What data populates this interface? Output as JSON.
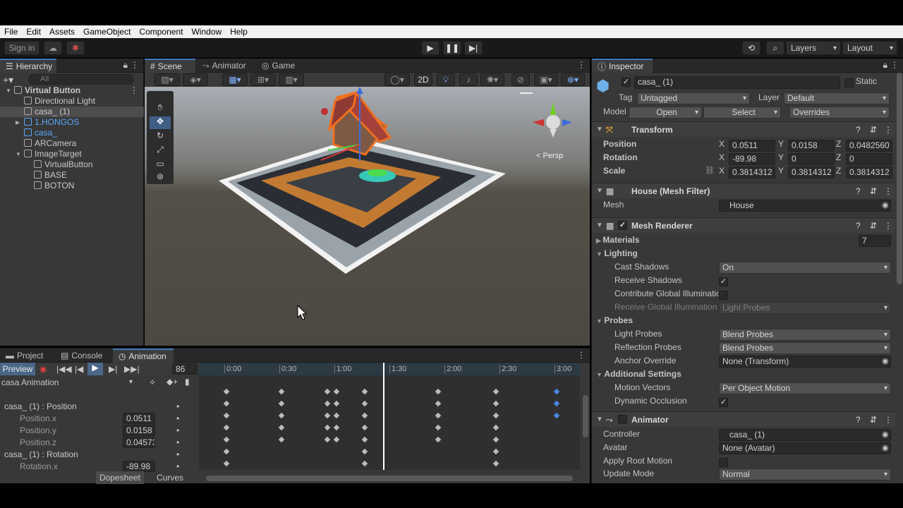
{
  "menu": [
    "File",
    "Edit",
    "Assets",
    "GameObject",
    "Component",
    "Window",
    "Help"
  ],
  "toolbar": {
    "sign_in": "Sign in",
    "layers": "Layers",
    "layout": "Layout"
  },
  "hierarchy": {
    "tab": "Hierarchy",
    "search_placeholder": "All",
    "items": [
      {
        "label": "Virtual Button",
        "indent": 0,
        "bold": true
      },
      {
        "label": "Directional Light",
        "indent": 1
      },
      {
        "label": "casa_ (1)",
        "indent": 1,
        "selected": true
      },
      {
        "label": "1.HONGOS",
        "indent": 1,
        "blue": true
      },
      {
        "label": "casa_",
        "indent": 1,
        "blue": true
      },
      {
        "label": "ARCamera",
        "indent": 1
      },
      {
        "label": "ImageTarget",
        "indent": 1
      },
      {
        "label": "VirtualButton",
        "indent": 2
      },
      {
        "label": "BASE",
        "indent": 2
      },
      {
        "label": "BOTON",
        "indent": 2
      }
    ]
  },
  "scene": {
    "tabs": [
      "Scene",
      "Animator",
      "Game"
    ],
    "mode_2d": "2D",
    "persp": "< Persp"
  },
  "animation": {
    "tabs": [
      "Project",
      "Console",
      "Animation"
    ],
    "preview": "Preview",
    "frame": "86",
    "clip": "casa Animation",
    "timeline": [
      "0:00",
      "0:30",
      "1:00",
      "1:30",
      "2:00",
      "2:30",
      "3:00"
    ],
    "props": [
      {
        "name": "casa_ (1) : Position",
        "value": "",
        "group": true
      },
      {
        "name": "Position.x",
        "value": "0.0511"
      },
      {
        "name": "Position.y",
        "value": "0.0158"
      },
      {
        "name": "Position.z",
        "value": "0.04573"
      },
      {
        "name": "casa_ (1) : Rotation",
        "value": "",
        "group": true
      },
      {
        "name": "Rotation.x",
        "value": "-89.98"
      }
    ],
    "dopesheet": "Dopesheet",
    "curves": "Curves"
  },
  "inspector": {
    "tab": "Inspector",
    "object_name": "casa_ (1)",
    "static": "Static",
    "tag_label": "Tag",
    "tag": "Untagged",
    "layer_label": "Layer",
    "layer": "Default",
    "model_label": "Model",
    "open": "Open",
    "select": "Select",
    "overrides": "Overrides",
    "transform": {
      "title": "Transform",
      "position_label": "Position",
      "rotation_label": "Rotation",
      "scale_label": "Scale",
      "position": [
        "0.0511",
        "0.0158",
        "0.0482560"
      ],
      "rotation": [
        "-89.98",
        "0",
        "0"
      ],
      "scale": [
        "0.3814312",
        "0.3814312",
        "0.3814312"
      ]
    },
    "mesh_filter": {
      "title": "House (Mesh Filter)",
      "mesh_label": "Mesh",
      "mesh": "House"
    },
    "mesh_renderer": {
      "title": "Mesh Renderer",
      "materials": "Materials",
      "materials_count": "7",
      "lighting": "Lighting",
      "cast_shadows_label": "Cast Shadows",
      "cast_shadows": "On",
      "receive_shadows_label": "Receive Shadows",
      "contribute_gi_label": "Contribute Global Illuminatio",
      "receive_gi_label": "Receive Global Illumination",
      "receive_gi": "Light Probes",
      "probes": "Probes",
      "light_probes_label": "Light Probes",
      "light_probes": "Blend Probes",
      "reflection_probes_label": "Reflection Probes",
      "reflection_probes": "Blend Probes",
      "anchor_override_label": "Anchor Override",
      "anchor_override": "None (Transform)",
      "additional": "Additional Settings",
      "motion_vectors_label": "Motion Vectors",
      "motion_vectors": "Per Object Motion",
      "dynamic_occlusion_label": "Dynamic Occlusion"
    },
    "animator": {
      "title": "Animator",
      "controller_label": "Controller",
      "controller": "casa_ (1)",
      "avatar_label": "Avatar",
      "avatar": "None (Avatar)",
      "apply_root_label": "Apply Root Motion",
      "update_mode_label": "Update Mode",
      "update_mode": "Normal"
    }
  }
}
